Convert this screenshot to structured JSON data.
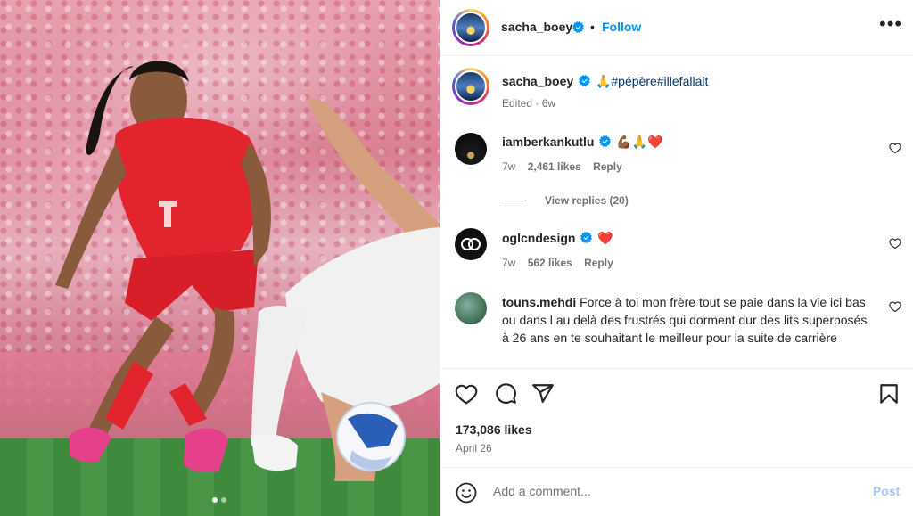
{
  "post": {
    "author": "sacha_boey",
    "follow_label": "Follow",
    "follow_separator": "•",
    "caption_lead": "🙏",
    "caption_hashtags": "#pépère#illefallait",
    "caption_meta": "Edited · 6w",
    "likes": "173,086 likes",
    "date": "April 26",
    "carousel_index": 1,
    "carousel_total": 2
  },
  "comments": [
    {
      "username": "iamberkankutlu",
      "text": "💪🏾🙏❤️",
      "time": "7w",
      "likes": "2,461 likes",
      "reply_label": "Reply",
      "view_replies": "View replies (20)"
    },
    {
      "username": "oglcndesign",
      "text": "❤️",
      "time": "7w",
      "likes": "562 likes",
      "reply_label": "Reply"
    },
    {
      "username": "touns.mehdi",
      "text": "Force à toi mon frère tout se paie dans la vie ici bas ou dans l au delà des frustrés qui dorment dur des lits superposés à 26 ans en te souhaitant le meilleur pour la suite de carrière"
    }
  ],
  "composer": {
    "placeholder": "Add a comment...",
    "post_label": "Post"
  },
  "colors": {
    "accent": "#0095f6",
    "link": "#00376b",
    "post_disabled": "#a8c7fa",
    "muted": "#737373",
    "heart_red": "#ff3040"
  },
  "icons": [
    "more-icon",
    "verified-icon",
    "heart-icon",
    "comment-icon",
    "share-icon",
    "bookmark-icon",
    "emoji-icon"
  ]
}
